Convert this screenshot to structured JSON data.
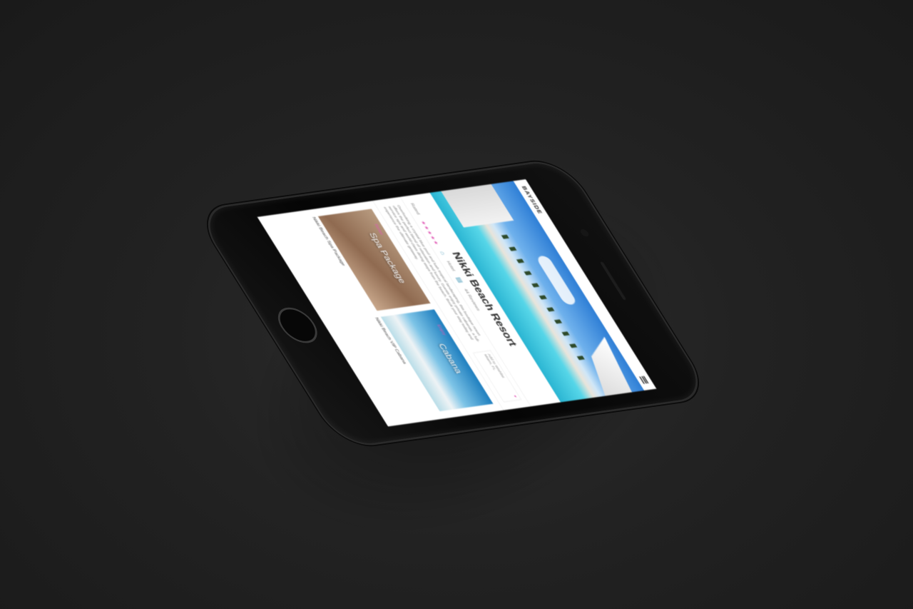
{
  "brand": {
    "logo_text": "BAYSIDE",
    "accent_color": "#e05ab5"
  },
  "hero": {
    "image": "resort-pool-photo"
  },
  "listing": {
    "title": "Nikki Beach Resort",
    "rating_label": "Rated",
    "rating_stars": "★★★★★",
    "meta_1": "Hotel",
    "meta_2": "44 Reviews",
    "description": "Overlooking a crystal blue pool and lush tropical landscaping, this boutique resort offers the perfect blend of relaxation and luxury. Guests enjoy private cabanas, a full-service spa and world-class dining steps from the beach. Book your stay today and experience the ultimate getaway.",
    "side_panel_label": "Add to Wishlist",
    "side_panel_value": "Miami, FL"
  },
  "cards": [
    {
      "tag": "Relax",
      "label": "Spa Package",
      "caption": "Nikki Beach Spa Package"
    },
    {
      "tag": "Enjoy",
      "label": "Cabana",
      "caption": "Nikki Beach VIP Cabana"
    }
  ]
}
